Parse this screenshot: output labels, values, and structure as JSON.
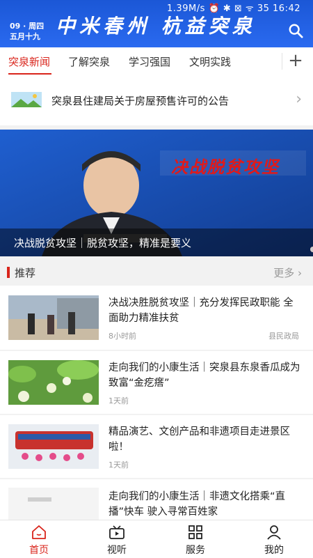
{
  "status_bar": {
    "text": "1.39M/s  ⏰ ✱ ⊠ ᯤ 35  16:42"
  },
  "header": {
    "date_line1": "09 · 周四",
    "date_line2": "五月十九",
    "logo_text": "中米春州  杭益突泉",
    "accent": "#2a6af0"
  },
  "tabs": [
    {
      "label": "突泉新闻",
      "active": true
    },
    {
      "label": "了解突泉",
      "active": false
    },
    {
      "label": "学习强国",
      "active": false
    },
    {
      "label": "文明实践",
      "active": false
    }
  ],
  "notice": {
    "text": "突泉县住建局关于房屋预售许可的公告"
  },
  "banner": {
    "slogan": "决战脱贫攻坚",
    "caption": "决战脱贫攻坚｜脱贫攻坚，精准是要义",
    "slide_count": 3,
    "active_slide": 2
  },
  "recommend": {
    "title": "推荐",
    "more": "更多"
  },
  "news": [
    {
      "title": "决战决胜脱贫攻坚｜充分发挥民政职能 全面助力精准扶贫",
      "time": "8小时前",
      "source": "县民政局"
    },
    {
      "title": "走向我们的小康生活｜突泉县东泉香瓜成为致富“金疙瘩”",
      "time": "1天前",
      "source": ""
    },
    {
      "title": "精品演艺、文创产品和非遗项目走进景区啦！",
      "time": "1天前",
      "source": ""
    },
    {
      "title": "走向我们的小康生活｜非遗文化搭乘“直播”快车 驶入寻常百姓家",
      "time": "",
      "source": ""
    }
  ],
  "bottom_nav": [
    {
      "label": "首页",
      "icon": "home-icon",
      "active": true
    },
    {
      "label": "视听",
      "icon": "video-icon",
      "active": false
    },
    {
      "label": "服务",
      "icon": "grid-icon",
      "active": false
    },
    {
      "label": "我的",
      "icon": "user-icon",
      "active": false
    }
  ],
  "colors": {
    "red": "#d9241b",
    "blue": "#1b57d6"
  }
}
